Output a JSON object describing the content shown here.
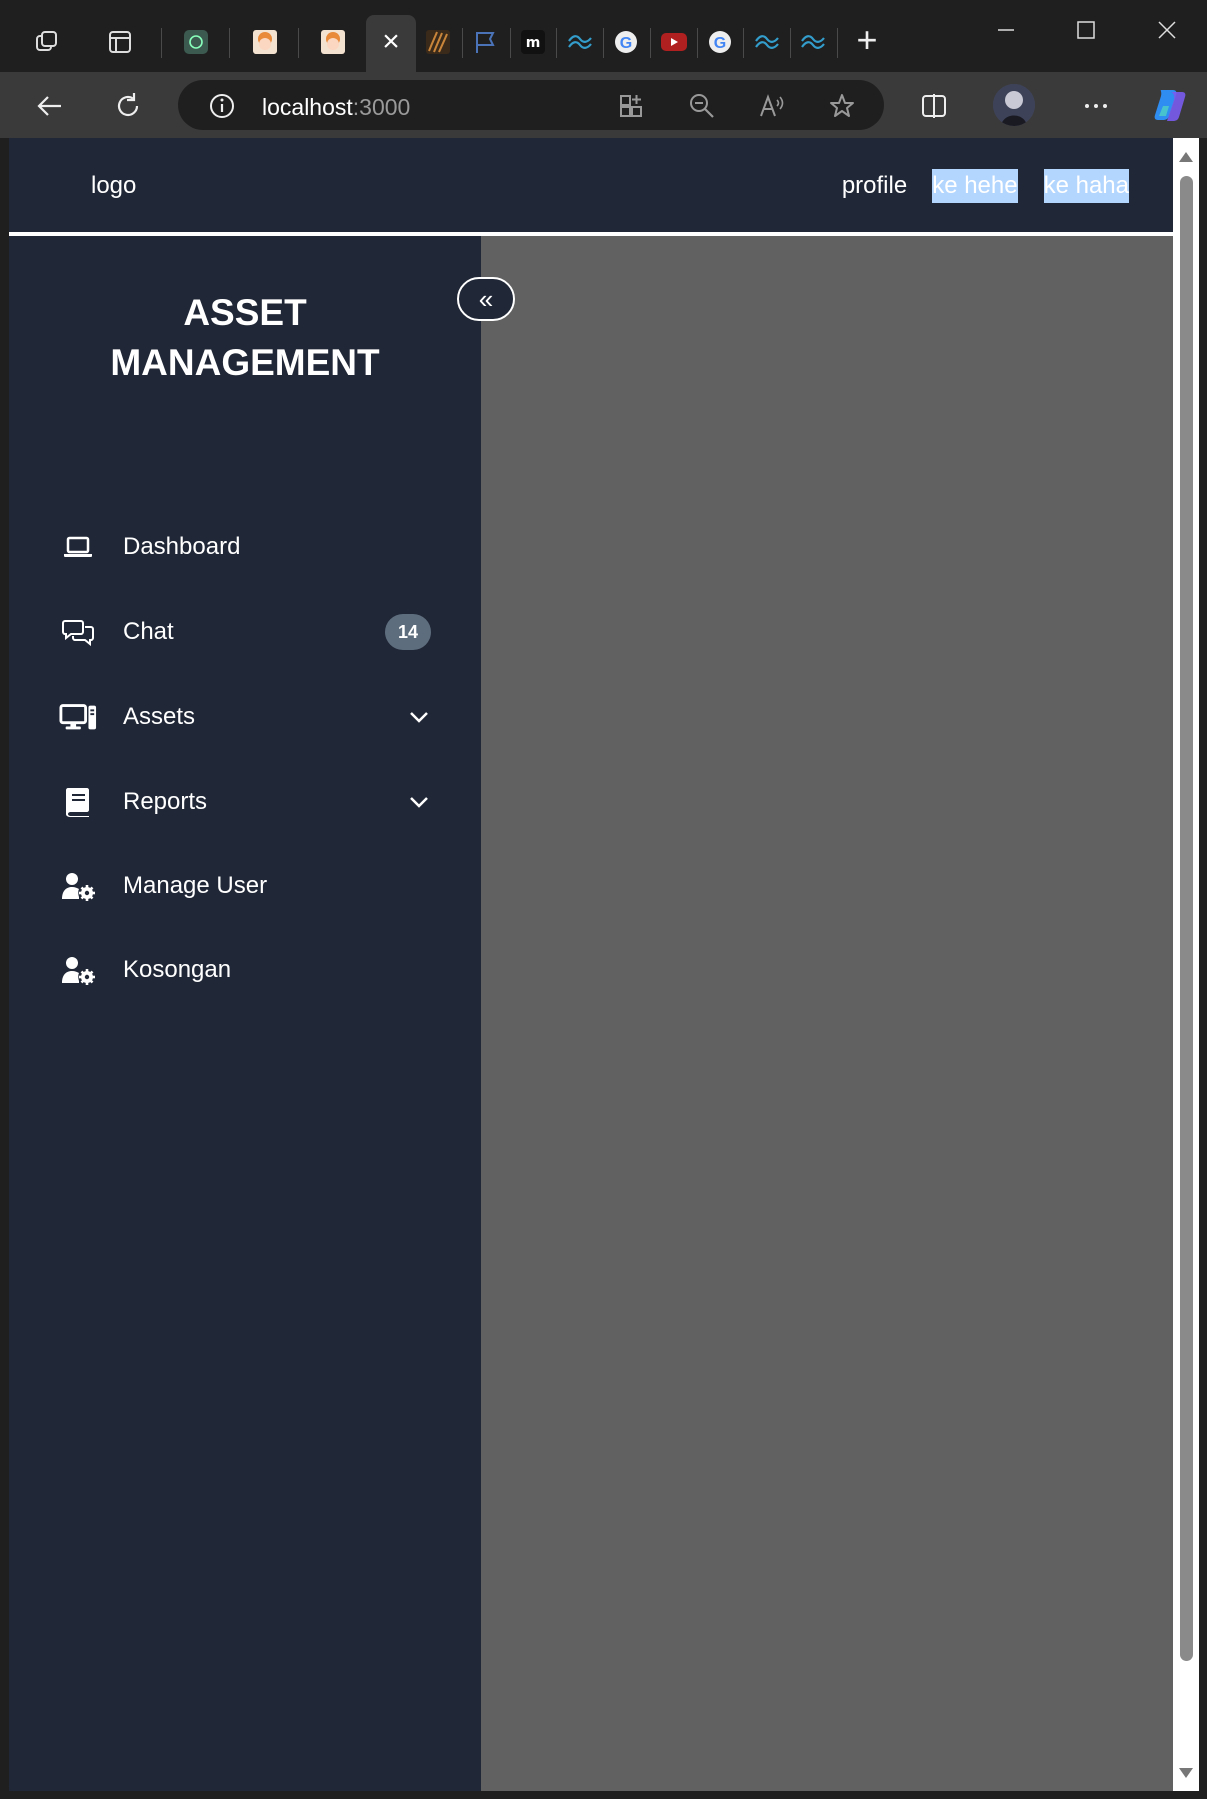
{
  "browser": {
    "url_host": "localhost",
    "url_port": ":3000",
    "tab_close_glyph": "×",
    "new_tab_glyph": "+"
  },
  "topnav": {
    "logo": "logo",
    "links": [
      "profile",
      "ke hehe",
      "ke haha"
    ]
  },
  "sidebar": {
    "title_line1": "ASSET",
    "title_line2": "MANAGEMENT",
    "toggle_glyph": "«",
    "items": [
      {
        "label": "Dashboard",
        "icon": "laptop-icon"
      },
      {
        "label": "Chat",
        "icon": "chat-bubbles-icon",
        "badge": "14"
      },
      {
        "label": "Assets",
        "icon": "desktop-computer-icon",
        "expandable": true
      },
      {
        "label": "Reports",
        "icon": "book-icon",
        "expandable": true
      },
      {
        "label": "Manage User",
        "icon": "user-gear-icon"
      },
      {
        "label": "Kosongan",
        "icon": "user-gear-icon"
      }
    ]
  },
  "colors": {
    "sidebar_bg": "#202736",
    "content_bg": "#616161",
    "badge_bg": "#5d6d7e",
    "selection": "#b3d6ff"
  }
}
